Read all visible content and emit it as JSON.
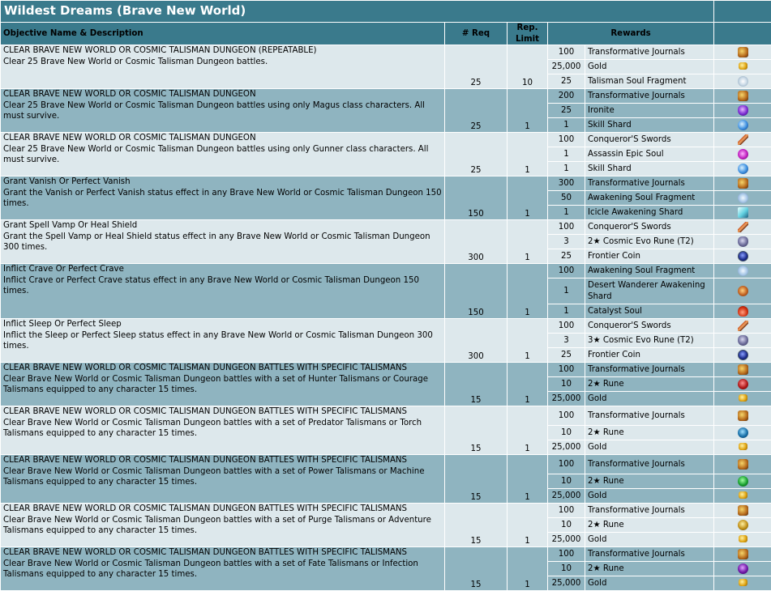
{
  "title": "Wildest Dreams (Brave New World)",
  "headers": {
    "objective": "Objective Name & Description",
    "req": "# Req",
    "limit": "Rep. Limit",
    "rewards": "Rewards"
  },
  "objectives": [
    {
      "name": "CLEAR BRAVE NEW WORLD OR COSMIC TALISMAN DUNGEON (REPEATABLE)",
      "desc": "Clear 25 Brave New World or Cosmic Talisman Dungeon battles.",
      "req": "25",
      "limit": "10",
      "rewards": [
        {
          "qty": "100",
          "item": "Transformative Journals",
          "icon": "journal-icon"
        },
        {
          "qty": "25,000",
          "item": "Gold",
          "icon": "gold-icon"
        },
        {
          "qty": "25",
          "item": "Talisman Soul Fragment",
          "icon": "talisman-fragment-icon"
        }
      ]
    },
    {
      "name": "CLEAR BRAVE NEW WORLD OR COSMIC TALISMAN DUNGEON",
      "desc": "Clear 25 Brave New World or Cosmic Talisman Dungeon battles using only Magus class characters. All must survive.",
      "req": "25",
      "limit": "1",
      "rewards": [
        {
          "qty": "200",
          "item": "Transformative Journals",
          "icon": "journal-icon"
        },
        {
          "qty": "25",
          "item": "Ironite",
          "icon": "ironite-icon"
        },
        {
          "qty": "1",
          "item": "Skill Shard",
          "icon": "skill-shard-icon"
        }
      ]
    },
    {
      "name": "CLEAR BRAVE NEW WORLD OR COSMIC TALISMAN DUNGEON",
      "desc": "Clear 25 Brave New World or Cosmic Talisman Dungeon battles using only Gunner class characters. All must survive.",
      "req": "25",
      "limit": "1",
      "rewards": [
        {
          "qty": "100",
          "item": "Conqueror'S Swords",
          "icon": "sword-icon"
        },
        {
          "qty": "1",
          "item": "Assassin Epic Soul",
          "icon": "epic-soul-icon"
        },
        {
          "qty": "1",
          "item": "Skill Shard",
          "icon": "skill-shard-icon"
        }
      ]
    },
    {
      "name": "Grant Vanish Or Perfect Vanish",
      "desc": "Grant the Vanish or Perfect Vanish status effect in any Brave New World or Cosmic Talisman Dungeon 150 times.",
      "req": "150",
      "limit": "1",
      "rewards": [
        {
          "qty": "300",
          "item": "Transformative Journals",
          "icon": "journal-icon"
        },
        {
          "qty": "50",
          "item": "Awakening Soul Fragment",
          "icon": "awakening-fragment-icon"
        },
        {
          "qty": "1",
          "item": "Icicle Awakening Shard",
          "icon": "icicle-shard-icon"
        }
      ]
    },
    {
      "name": "Grant Spell Vamp Or Heal Shield",
      "desc": "Grant the Spell Vamp or Heal Shield status effect in any Brave New World or Cosmic Talisman Dungeon 300 times.",
      "req": "300",
      "limit": "1",
      "rewards": [
        {
          "qty": "100",
          "item": "Conqueror'S Swords",
          "icon": "sword-icon"
        },
        {
          "qty": "3",
          "item": "2★ Cosmic Evo Rune (T2)",
          "icon": "cosmic-rune-icon"
        },
        {
          "qty": "25",
          "item": "Frontier Coin",
          "icon": "frontier-coin-icon"
        }
      ]
    },
    {
      "name": "Inflict Crave Or Perfect Crave",
      "desc": "Inflict Crave or Perfect Crave status effect in any Brave New World or Cosmic Talisman Dungeon 150 times.",
      "req": "150",
      "limit": "1",
      "rewards": [
        {
          "qty": "100",
          "item": "Awakening Soul Fragment",
          "icon": "awakening-fragment-icon"
        },
        {
          "qty": "1",
          "item": "Desert Wanderer Awakening Shard",
          "icon": "desert-shard-icon"
        },
        {
          "qty": "1",
          "item": "Catalyst Soul",
          "icon": "catalyst-soul-icon"
        }
      ]
    },
    {
      "name": "Inflict Sleep Or Perfect Sleep",
      "desc": "Inflict the Sleep or Perfect Sleep status effect in any Brave New World or Cosmic Talisman Dungeon 300 times.",
      "req": "300",
      "limit": "1",
      "rewards": [
        {
          "qty": "100",
          "item": "Conqueror'S Swords",
          "icon": "sword-icon"
        },
        {
          "qty": "3",
          "item": "3★ Cosmic Evo Rune (T2)",
          "icon": "cosmic-rune-icon"
        },
        {
          "qty": "25",
          "item": "Frontier Coin",
          "icon": "frontier-coin-icon"
        }
      ]
    },
    {
      "name": "CLEAR BRAVE NEW WORLD OR COSMIC TALISMAN DUNGEON BATTLES WITH SPECIFIC TALISMANS",
      "desc": "Clear Brave New World or Cosmic Talisman Dungeon battles with a set of Hunter Talismans or Courage Talismans equipped to any character 15 times.",
      "req": "15",
      "limit": "1",
      "rewards": [
        {
          "qty": "100",
          "item": "Transformative Journals",
          "icon": "journal-icon"
        },
        {
          "qty": "10",
          "item": "2★ Rune",
          "icon": "rune-red-icon"
        },
        {
          "qty": "25,000",
          "item": "Gold",
          "icon": "gold-icon"
        }
      ]
    },
    {
      "name": "CLEAR BRAVE NEW WORLD OR COSMIC TALISMAN DUNGEON BATTLES WITH SPECIFIC TALISMANS",
      "desc": "Clear Brave New World or Cosmic Talisman Dungeon battles with a set of Predator Talismans or Torch Talismans equipped to any character 15 times.",
      "req": "15",
      "limit": "1",
      "rewards": [
        {
          "qty": "100",
          "item": "Transformative Journals",
          "icon": "journal-icon"
        },
        {
          "qty": "10",
          "item": "2★ Rune",
          "icon": "rune-blue-icon"
        },
        {
          "qty": "25,000",
          "item": "Gold",
          "icon": "gold-icon"
        }
      ]
    },
    {
      "name": "CLEAR BRAVE NEW WORLD OR COSMIC TALISMAN DUNGEON BATTLES WITH SPECIFIC TALISMANS",
      "desc": "Clear Brave New World or Cosmic Talisman Dungeon battles with a set of Power Talismans or Machine Talismans equipped to any character 15 times.",
      "req": "15",
      "limit": "1",
      "rewards": [
        {
          "qty": "100",
          "item": "Transformative Journals",
          "icon": "journal-icon"
        },
        {
          "qty": "10",
          "item": "2★ Rune",
          "icon": "rune-green-icon"
        },
        {
          "qty": "25,000",
          "item": "Gold",
          "icon": "gold-icon"
        }
      ]
    },
    {
      "name": "CLEAR BRAVE NEW WORLD OR COSMIC TALISMAN DUNGEON BATTLES WITH SPECIFIC TALISMANS",
      "desc": "Clear Brave New World or Cosmic Talisman Dungeon battles with a set of Purge Talismans or Adventure Talismans equipped to any character 15 times.",
      "req": "15",
      "limit": "1",
      "rewards": [
        {
          "qty": "100",
          "item": "Transformative Journals",
          "icon": "journal-icon"
        },
        {
          "qty": "10",
          "item": "2★ Rune",
          "icon": "rune-yellow-icon"
        },
        {
          "qty": "25,000",
          "item": "Gold",
          "icon": "gold-icon"
        }
      ]
    },
    {
      "name": "CLEAR BRAVE NEW WORLD OR COSMIC TALISMAN DUNGEON BATTLES WITH SPECIFIC TALISMANS",
      "desc": "Clear Brave New World or Cosmic Talisman Dungeon battles with a set of Fate Talismans or Infection Talismans equipped to any character 15 times.",
      "req": "15",
      "limit": "1",
      "rewards": [
        {
          "qty": "100",
          "item": "Transformative Journals",
          "icon": "journal-icon"
        },
        {
          "qty": "10",
          "item": "2★ Rune",
          "icon": "rune-purple-icon"
        },
        {
          "qty": "25,000",
          "item": "Gold",
          "icon": "gold-icon"
        }
      ]
    }
  ]
}
